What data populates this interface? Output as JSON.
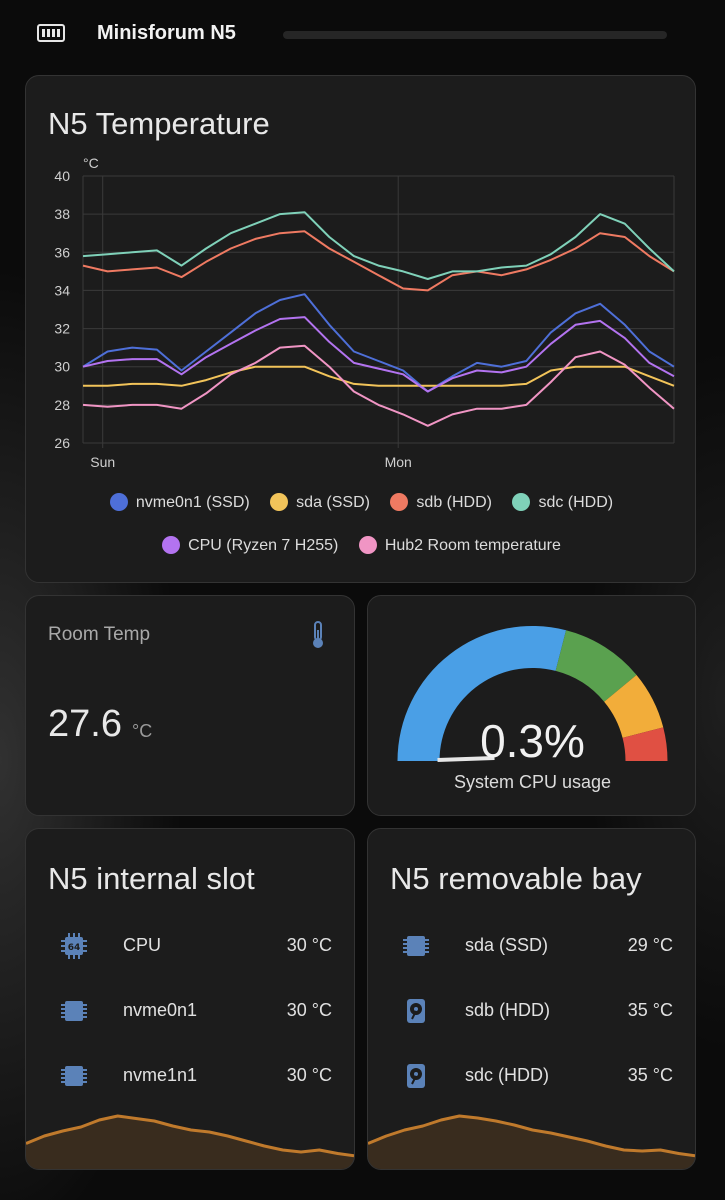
{
  "header": {
    "title": "Minisforum N5",
    "icon": "nas-icon"
  },
  "temperature_card": {
    "title": "N5 Temperature",
    "legend": [
      {
        "label": "nvme0n1 (SSD)",
        "color": "#4e6fd8"
      },
      {
        "label": "sda (SSD)",
        "color": "#f2c45a"
      },
      {
        "label": "sdb (HDD)",
        "color": "#ef7a62"
      },
      {
        "label": "sdc (HDD)",
        "color": "#7fd1b9"
      },
      {
        "label": "CPU (Ryzen 7 H255)",
        "color": "#b373f0"
      },
      {
        "label": "Hub2 Room temperature",
        "color": "#f095c4"
      }
    ]
  },
  "chart_data": {
    "type": "line",
    "ylabel": "°C",
    "ylim": [
      26,
      40
    ],
    "yticks": [
      "40",
      "38",
      "36",
      "34",
      "32",
      "30",
      "28",
      "26"
    ],
    "xticks": [
      "Sun",
      "Mon"
    ],
    "grid": true,
    "legend_position": "bottom",
    "x": [
      0,
      0.25,
      0.5,
      0.75,
      1,
      1.25,
      1.5,
      1.75,
      2,
      2.25,
      2.5,
      2.75,
      3,
      3.25,
      3.5,
      3.75,
      4,
      4.25,
      4.5,
      4.75,
      5,
      5.25,
      5.5,
      5.75,
      6
    ],
    "series": [
      {
        "name": "nvme0n1 (SSD)",
        "color": "#4e6fd8",
        "values": [
          30.0,
          30.8,
          31.0,
          30.9,
          29.8,
          30.8,
          31.8,
          32.8,
          33.5,
          33.8,
          32.2,
          30.8,
          30.3,
          29.8,
          28.7,
          29.5,
          30.2,
          30.0,
          30.3,
          31.8,
          32.8,
          33.3,
          32.2,
          30.8,
          30.0
        ]
      },
      {
        "name": "sda (SSD)",
        "color": "#f2c45a",
        "values": [
          29.0,
          29.0,
          29.1,
          29.1,
          29.0,
          29.3,
          29.7,
          30.0,
          30.0,
          30.0,
          29.5,
          29.1,
          29.0,
          29.0,
          29.0,
          29.0,
          29.0,
          29.0,
          29.1,
          29.8,
          30.0,
          30.0,
          30.0,
          29.5,
          29.0
        ]
      },
      {
        "name": "sdb (HDD)",
        "color": "#ef7a62",
        "values": [
          35.3,
          35.0,
          35.1,
          35.2,
          34.7,
          35.5,
          36.2,
          36.7,
          37.0,
          37.1,
          36.2,
          35.5,
          34.8,
          34.1,
          34.0,
          34.8,
          35.0,
          34.8,
          35.1,
          35.6,
          36.2,
          37.0,
          36.8,
          35.8,
          35.0
        ]
      },
      {
        "name": "sdc (HDD)",
        "color": "#7fd1b9",
        "values": [
          35.8,
          35.9,
          36.0,
          36.1,
          35.3,
          36.2,
          37.0,
          37.5,
          38.0,
          38.1,
          36.8,
          35.8,
          35.3,
          35.0,
          34.6,
          35.0,
          35.0,
          35.2,
          35.3,
          35.9,
          36.8,
          38.0,
          37.5,
          36.2,
          35.0
        ]
      },
      {
        "name": "CPU (Ryzen 7 H255)",
        "color": "#b373f0",
        "values": [
          30.0,
          30.3,
          30.4,
          30.4,
          29.6,
          30.5,
          31.2,
          31.9,
          32.5,
          32.6,
          31.3,
          30.2,
          29.9,
          29.6,
          28.7,
          29.4,
          29.8,
          29.7,
          30.0,
          31.2,
          32.2,
          32.4,
          31.5,
          30.2,
          29.5
        ]
      },
      {
        "name": "Hub2 Room temperature",
        "color": "#f095c4",
        "values": [
          28.0,
          27.9,
          28.0,
          28.0,
          27.8,
          28.6,
          29.6,
          30.2,
          31.0,
          31.1,
          30.0,
          28.7,
          28.0,
          27.5,
          26.9,
          27.5,
          27.8,
          27.8,
          28.0,
          29.2,
          30.5,
          30.8,
          30.1,
          28.9,
          27.8
        ]
      }
    ]
  },
  "room_temp": {
    "label": "Room Temp",
    "value": "27.6",
    "unit": "°C",
    "icon": "thermometer-icon"
  },
  "cpu_gauge": {
    "value": "0.3%",
    "label": "System CPU usage",
    "level": 0.003,
    "segments": [
      {
        "from": 0,
        "to": 0.58,
        "color": "#4a9fe6"
      },
      {
        "from": 0.58,
        "to": 0.78,
        "color": "#5aa14f"
      },
      {
        "from": 0.78,
        "to": 0.92,
        "color": "#f2ad3a"
      },
      {
        "from": 0.92,
        "to": 1.0,
        "color": "#e05043"
      }
    ]
  },
  "internal_slot": {
    "title": "N5 internal slot",
    "rows": [
      {
        "icon": "cpu-64bit-icon",
        "name": "CPU",
        "value": "30 °C"
      },
      {
        "icon": "memory-chip-icon",
        "name": "nvme0n1",
        "value": "30 °C"
      },
      {
        "icon": "memory-chip-icon",
        "name": "nvme1n1",
        "value": "30 °C"
      }
    ],
    "sparkline": {
      "color": "#c07a2c",
      "values": [
        0.35,
        0.5,
        0.6,
        0.68,
        0.82,
        0.9,
        0.85,
        0.8,
        0.7,
        0.62,
        0.58,
        0.5,
        0.4,
        0.3,
        0.22,
        0.18,
        0.22,
        0.15,
        0.1
      ]
    }
  },
  "removable_bay": {
    "title": "N5 removable bay",
    "rows": [
      {
        "icon": "memory-chip-icon",
        "name": "sda (SSD)",
        "value": "29 °C"
      },
      {
        "icon": "harddisk-icon",
        "name": "sdb (HDD)",
        "value": "35 °C"
      },
      {
        "icon": "harddisk-icon",
        "name": "sdc (HDD)",
        "value": "35 °C"
      }
    ],
    "sparkline": {
      "color": "#c07a2c",
      "values": [
        0.35,
        0.5,
        0.62,
        0.7,
        0.82,
        0.9,
        0.86,
        0.8,
        0.72,
        0.62,
        0.56,
        0.48,
        0.4,
        0.3,
        0.22,
        0.2,
        0.22,
        0.15,
        0.1
      ]
    }
  }
}
